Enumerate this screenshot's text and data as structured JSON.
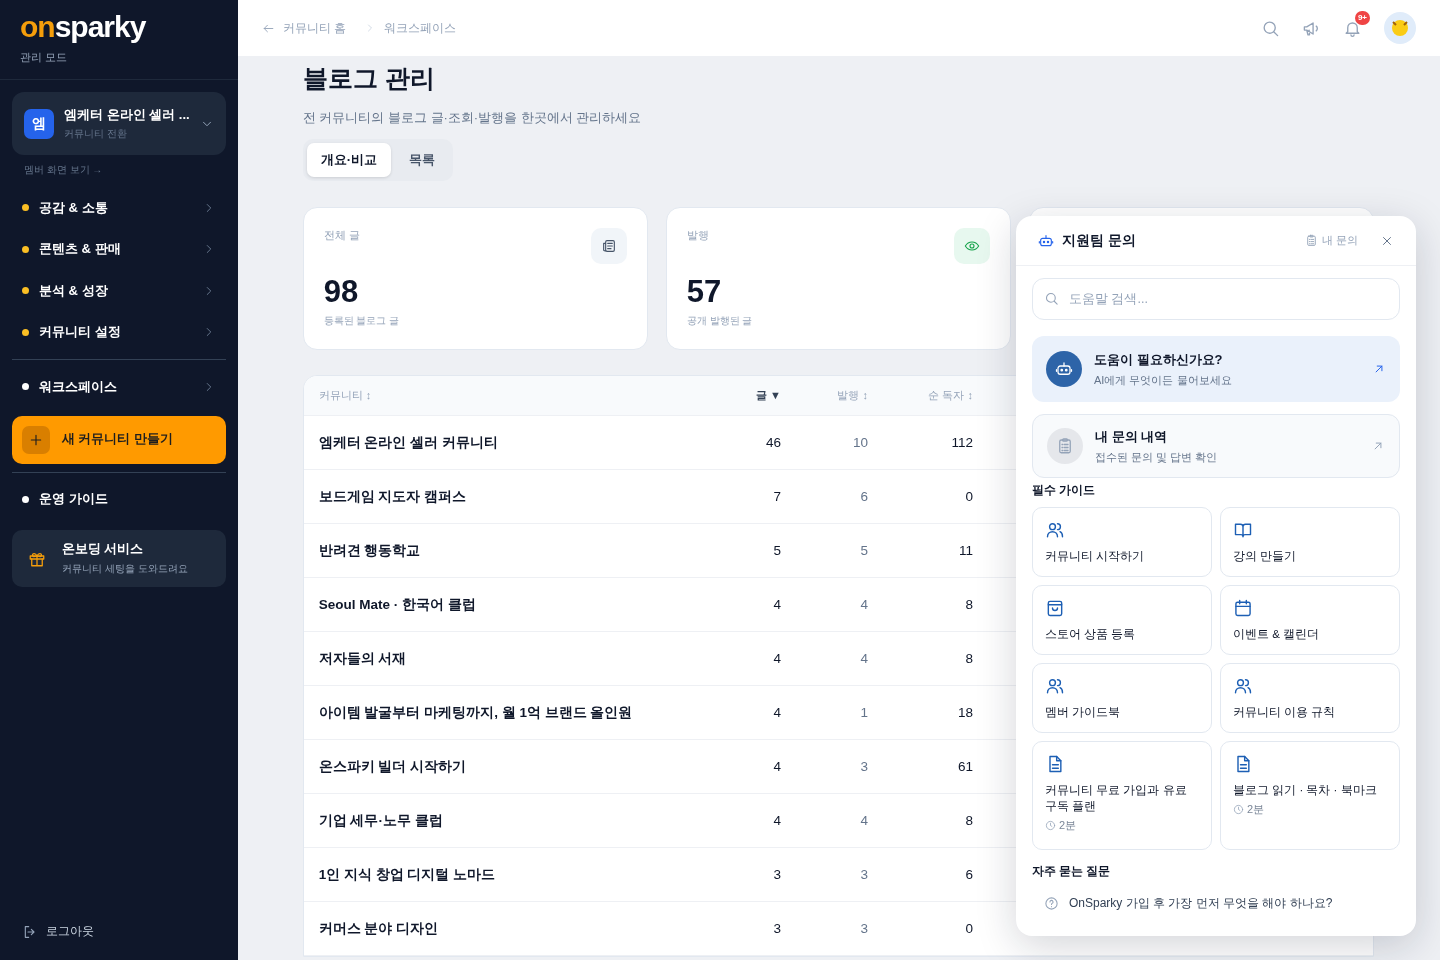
{
  "sidebar": {
    "logo": {
      "accent": "on",
      "rest": "sparky"
    },
    "mode": "관리 모드",
    "community_switcher": {
      "initial": "엠",
      "name": "엠케터 온라인 셀러 ...",
      "subtitle": "커뮤니티 전환"
    },
    "member_view_link": "멤버 화면 보기 →",
    "menu_groups": [
      {
        "items": [
          {
            "label": "공감 & 소통",
            "color": "#fbbf24",
            "chevron": true
          },
          {
            "label": "콘텐츠 & 판매",
            "color": "#fbbf24",
            "chevron": true
          },
          {
            "label": "분석 & 성장",
            "color": "#fbbf24",
            "chevron": true
          },
          {
            "label": "커뮤니티 설정",
            "color": "#fbbf24",
            "chevron": true
          }
        ]
      },
      {
        "items": [
          {
            "label": "워크스페이스",
            "color": "#ffffff",
            "chevron": true
          }
        ]
      }
    ],
    "create_button": {
      "label": "새 커뮤니티 만들기"
    },
    "guide_item": {
      "label": "운영 가이드",
      "color": "#ffffff",
      "chevron": false
    },
    "onboarding": {
      "title": "온보딩 서비스",
      "subtitle": "커뮤니티 세팅을 도와드려요"
    },
    "logout": "로그아웃"
  },
  "header": {
    "breadcrumbs": [
      "커뮤니티 홈",
      "워크스페이스"
    ],
    "notification_badge": "9+"
  },
  "page": {
    "title": "블로그 관리",
    "subtitle": "전 커뮤니티의 블로그 글·조회·발행을 한곳에서 관리하세요",
    "tabs": [
      {
        "label": "개요·비교",
        "selected": true
      },
      {
        "label": "목록",
        "selected": false
      }
    ],
    "stat_cards": [
      {
        "kind": "total",
        "label": "전체 글",
        "value": "98",
        "caption": "등록된 블로그 글"
      },
      {
        "kind": "published",
        "label": "발행",
        "value": "57",
        "caption": "공개 발행된 글"
      }
    ],
    "table": {
      "columns": [
        {
          "label": "커뮤니티 ↕",
          "selected": false
        },
        {
          "label": "글 ▼",
          "selected": true
        },
        {
          "label": "발행 ↕",
          "selected": false
        },
        {
          "label": "순 독자 ↕",
          "selected": false
        }
      ],
      "rows": [
        [
          "엠케터 온라인 셀러 커뮤니티",
          "46",
          "10",
          "112"
        ],
        [
          "보드게임 지도자 캠퍼스",
          "7",
          "6",
          "0"
        ],
        [
          "반려견 행동학교",
          "5",
          "5",
          "11"
        ],
        [
          "Seoul Mate · 한국어 클럽",
          "4",
          "4",
          "8"
        ],
        [
          "저자들의 서재",
          "4",
          "4",
          "8"
        ],
        [
          "아이템 발굴부터 마케팅까지, 월 1억 브랜드 올인원",
          "4",
          "1",
          "18"
        ],
        [
          "온스파키 빌더 시작하기",
          "4",
          "3",
          "61"
        ],
        [
          "기업 세무·노무 클럽",
          "4",
          "4",
          "8"
        ],
        [
          "1인 지식 창업 디지털 노마드",
          "3",
          "3",
          "6"
        ],
        [
          "커머스 분야 디자인",
          "3",
          "3",
          "0"
        ]
      ]
    }
  },
  "support_panel": {
    "title": "지원팀 문의",
    "my_inquiries_link": "내 문의",
    "search": {
      "placeholder": "도움말 검색..."
    },
    "action_cards": [
      {
        "kind": "ai",
        "title": "도움이 필요하신가요?",
        "subtitle": "AI에게 무엇이든 물어보세요"
      },
      {
        "kind": "history",
        "title": "내 문의 내역",
        "subtitle": "접수된 문의 및 답변 확인"
      }
    ],
    "guides_heading": "필수 가이드",
    "guides": [
      {
        "kind": "users",
        "title": "커뮤니티 시작하기"
      },
      {
        "kind": "book",
        "title": "강의 만들기"
      },
      {
        "kind": "bag",
        "title": "스토어 상품 등록"
      },
      {
        "kind": "calendar",
        "title": "이벤트 & 캘린더"
      },
      {
        "kind": "users",
        "title": "멤버 가이드북"
      },
      {
        "kind": "users",
        "title": "커뮤니티 이용 규칙"
      },
      {
        "kind": "document",
        "title": "커뮤니티 무료 가입과 유료 구독 플랜",
        "time": "2분"
      },
      {
        "kind": "document",
        "title": "블로그 읽기 · 목차 · 북마크",
        "time": "2분"
      }
    ],
    "faq_heading": "자주 묻는 질문",
    "faq": [
      "OnSparky 가입 후 가장 먼저 무엇을 해야 하나요?"
    ]
  }
}
